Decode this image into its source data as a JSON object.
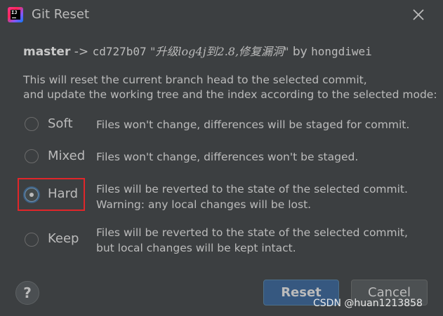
{
  "window": {
    "title": "Git Reset",
    "app_icon_text": "IJ",
    "icons": {
      "app": "intellij-icon",
      "close": "close-icon",
      "help": "help-icon"
    }
  },
  "header": {
    "branch": "master",
    "arrow": "->",
    "commit_hash": "cd727b07",
    "commit_message": "\"升级log4j到2.8,修复漏洞\"",
    "by": "by",
    "author": "hongdiwei"
  },
  "description": {
    "line1": "This will reset the current branch head to the selected commit,",
    "line2": "and update the working tree and the index according to the selected mode:"
  },
  "options": [
    {
      "label": "Soft",
      "desc1": "Files won't change, differences will be staged for commit.",
      "desc2": "",
      "checked": false
    },
    {
      "label": "Mixed",
      "desc1": "Files won't change, differences won't be staged.",
      "desc2": "",
      "checked": false
    },
    {
      "label": "Hard",
      "desc1": "Files will be reverted to the state of the selected commit.",
      "desc2": "Warning: any local changes will be lost.",
      "checked": true
    },
    {
      "label": "Keep",
      "desc1": "Files will be reverted to the state of the selected commit,",
      "desc2": "but local changes will be kept intact.",
      "checked": false
    }
  ],
  "buttons": {
    "help": "?",
    "reset": "Reset",
    "cancel": "Cancel"
  },
  "watermark": "CSDN @huan1213858",
  "colors": {
    "background": "#3c3f41",
    "text": "#bbbbbb",
    "primary_button": "#365880",
    "highlight_box": "#e0262a"
  }
}
